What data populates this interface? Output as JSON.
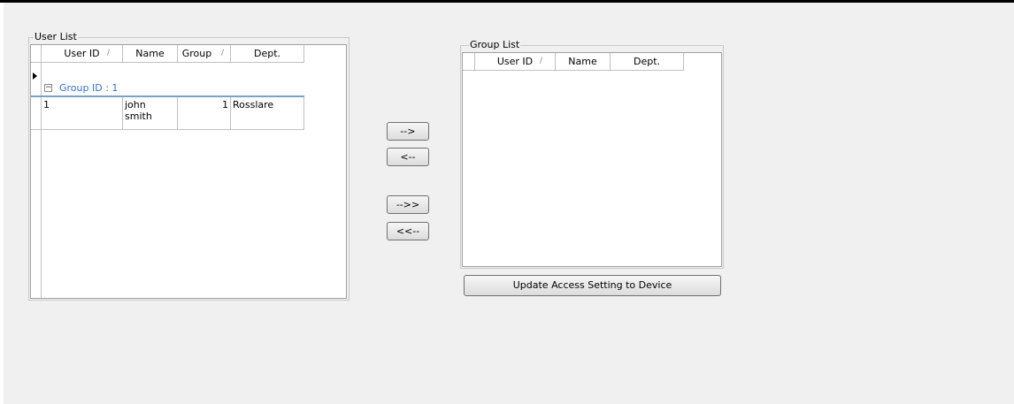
{
  "user_list": {
    "title": "User List",
    "columns": [
      "User ID",
      "Name",
      "Group",
      "Dept."
    ],
    "group_header": "Group ID : 1",
    "expander": "−",
    "rows": [
      {
        "user_id": "1",
        "name": "john\nsmith",
        "group": "1",
        "dept": "Rosslare"
      }
    ]
  },
  "transfer_buttons": {
    "move_right": "-->",
    "move_left": "<--",
    "move_all_right": "-->>",
    "move_all_left": "<<--"
  },
  "group_list": {
    "title": "Group List",
    "columns": [
      "User ID",
      "Name",
      "Dept."
    ]
  },
  "update_button": "Update Access Setting to Device"
}
